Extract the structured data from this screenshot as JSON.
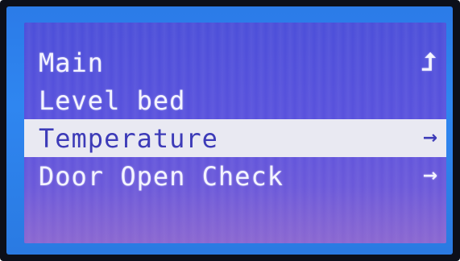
{
  "screen": {
    "colors": {
      "bezel": "#2f86f0",
      "screen_bg": "#4c4fd9",
      "text": "#f4f4ff",
      "highlight_bg": "#e9e9f2",
      "highlight_text": "#3d3bb8"
    }
  },
  "menu": {
    "items": [
      {
        "label": "Main",
        "icon": "up-arrow-icon",
        "glyph": "⮥",
        "selected": false
      },
      {
        "label": "Level bed",
        "icon": "",
        "glyph": "",
        "selected": false
      },
      {
        "label": "Temperature",
        "icon": "right-arrow-icon",
        "glyph": "→",
        "selected": true
      },
      {
        "label": "Door Open Check",
        "icon": "right-arrow-icon",
        "glyph": "→",
        "selected": false
      }
    ]
  }
}
